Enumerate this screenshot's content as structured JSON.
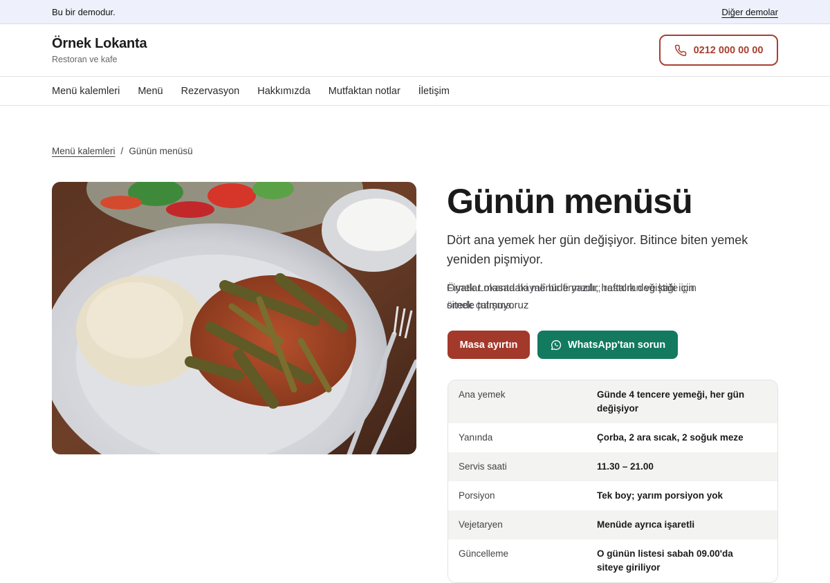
{
  "demo_bar": {
    "label": "Bu bir demodur.",
    "note": "Örnek Lokanta hayalî bir firmadır; restoran ve kafe için örnek çalışma.",
    "other_link": "Diğer demolar"
  },
  "header": {
    "brand_name": "Örnek Lokanta",
    "brand_sub": "Restoran ve kafe",
    "phone": "0212 000 00 00",
    "phone_icon": "phone-icon",
    "accent": "#a64031"
  },
  "nav": {
    "items": [
      "Menü kalemleri",
      "Menü",
      "Rezervasyon",
      "Hakkımızda",
      "Mutfaktan notlar",
      "İletişim"
    ]
  },
  "breadcrumb": {
    "parent": "Menü kalemleri",
    "separator": "/",
    "current": "Günün menüsü"
  },
  "main": {
    "title": "Günün menüsü",
    "lead": "Dört ana yemek her gün değişiyor. Bitince biten yemek yeniden pişmiyor.",
    "note": "Fiyatlar masadaki menüde yazılı; haftalık değiştiği için sitede tutmuyoruz",
    "reserve_button": "Masa ayırtın",
    "whatsapp_button": "WhatsApp'tan sorun",
    "whatsapp_icon": "whatsapp-icon",
    "image_alt": "green-beans-with-rice-plate",
    "details": [
      {
        "key": "Ana yemek",
        "value": "Günde 4 tencere yemeği, her gün değişiyor"
      },
      {
        "key": "Yanında",
        "value": "Çorba, 2 ara sıcak, 2 soğuk meze"
      },
      {
        "key": "Servis saati",
        "value": "11.30 – 21.00"
      },
      {
        "key": "Porsiyon",
        "value": "Tek boy; yarım porsiyon yok"
      },
      {
        "key": "Vejetaryen",
        "value": "Menüde ayrıca işaretli"
      },
      {
        "key": "Güncelleme",
        "value": "O günün listesi sabah 09.00'da siteye giriliyor"
      }
    ]
  },
  "colors": {
    "primary": "#a3392b",
    "whatsapp": "#137a5f",
    "demo_bar_bg": "#eef1fb"
  }
}
